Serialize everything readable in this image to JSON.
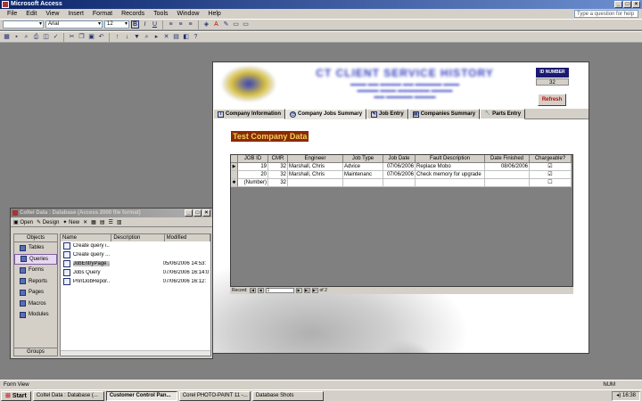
{
  "app": {
    "title": "Microsoft Access"
  },
  "menu": [
    "File",
    "Edit",
    "View",
    "Insert",
    "Format",
    "Records",
    "Tools",
    "Window",
    "Help"
  ],
  "help_placeholder": "Type a question for help",
  "toolbar": {
    "font": "Arial",
    "size": "12"
  },
  "form": {
    "banner": "CT CLIENT SERVICE HISTORY",
    "id_label": "ID NUMBER",
    "id_value": "32",
    "refresh": "Refresh",
    "tabs": [
      "Company Information",
      "Company Jobs Summary",
      "Job Entry",
      "Companies Summary",
      "Parts Entry"
    ],
    "active_tab": "Company Jobs Summary",
    "company_name": "Test Company Data",
    "columns": [
      "JOB ID",
      "CMR",
      "Engineer",
      "Job Type",
      "Job Date",
      "Fault Description",
      "Date Finished",
      "Chargeable?"
    ],
    "rows": [
      {
        "selector": "▶",
        "job_id": "19",
        "cmr": "32",
        "engineer": "Marshall, Chris",
        "job_type": "Advice",
        "job_date": "07/06/2006",
        "fault": "Replace Mobo",
        "finished": "08/06/2006",
        "chargeable": "☑"
      },
      {
        "selector": "",
        "job_id": "20",
        "cmr": "32",
        "engineer": "Marshall, Chris",
        "job_type": "Maintenanc",
        "job_date": "07/06/2006",
        "fault": "Check memory for upgrade",
        "finished": "",
        "chargeable": "☑"
      },
      {
        "selector": "✱",
        "job_id": "(Number)",
        "cmr": "32",
        "engineer": "",
        "job_type": "",
        "job_date": "",
        "fault": "",
        "finished": "",
        "chargeable": "☐"
      }
    ],
    "record_label": "Record:",
    "record_value": "1",
    "record_of": "of 2"
  },
  "dbwin": {
    "title": "Coltel Data : Database (Access 2000 file format)",
    "toolbar": [
      "Open",
      "Design",
      "New"
    ],
    "objects_header": "Objects",
    "objects": [
      "Tables",
      "Queries",
      "Forms",
      "Reports",
      "Pages",
      "Macros",
      "Modules"
    ],
    "active_object": "Queries",
    "groups": "Groups",
    "columns": [
      "Name",
      "Description",
      "Modified"
    ],
    "items": [
      {
        "name": "Create query i...",
        "desc": "",
        "modified": ""
      },
      {
        "name": "Create query ...",
        "desc": "",
        "modified": ""
      },
      {
        "name": "JobEntryPage ...",
        "desc": "",
        "modified": "05/06/2006 14:53:"
      },
      {
        "name": "Jobs Query",
        "desc": "",
        "modified": "07/06/2006 16:14:0"
      },
      {
        "name": "PrintJobRepor...",
        "desc": "",
        "modified": "07/06/2006 16:12:"
      }
    ]
  },
  "status": {
    "left": "Form View",
    "num": "NUM"
  },
  "taskbar": {
    "start": "Start",
    "tasks": [
      "Coltel Data : Database (...",
      "Customer Control Pan...",
      "Corel PHOTO-PAINT 11 -...",
      "Database Shots"
    ],
    "active_task": "Customer Control Pan...",
    "time": "16:38"
  }
}
